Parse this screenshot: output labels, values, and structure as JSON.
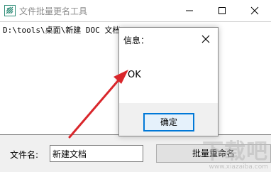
{
  "window": {
    "title": "文件批量更名工具",
    "icon": "app-leaf-icon",
    "controls": [
      "minimize-icon",
      "maximize-icon",
      "close-icon"
    ]
  },
  "editor": {
    "content": "D:\\tools\\桌面\\新建 DOC 文档.doc"
  },
  "footer": {
    "filename_label": "文件名:",
    "filename_value": "新建文档",
    "rename_button_label": "批量重命名"
  },
  "dialog": {
    "title": "信息：",
    "message": "OK",
    "ok_label": "确定"
  },
  "annotation": {
    "arrow_color": "#d9262b"
  },
  "watermark": {
    "text": "下载吧",
    "sub": "www.xiazaiba.com"
  }
}
